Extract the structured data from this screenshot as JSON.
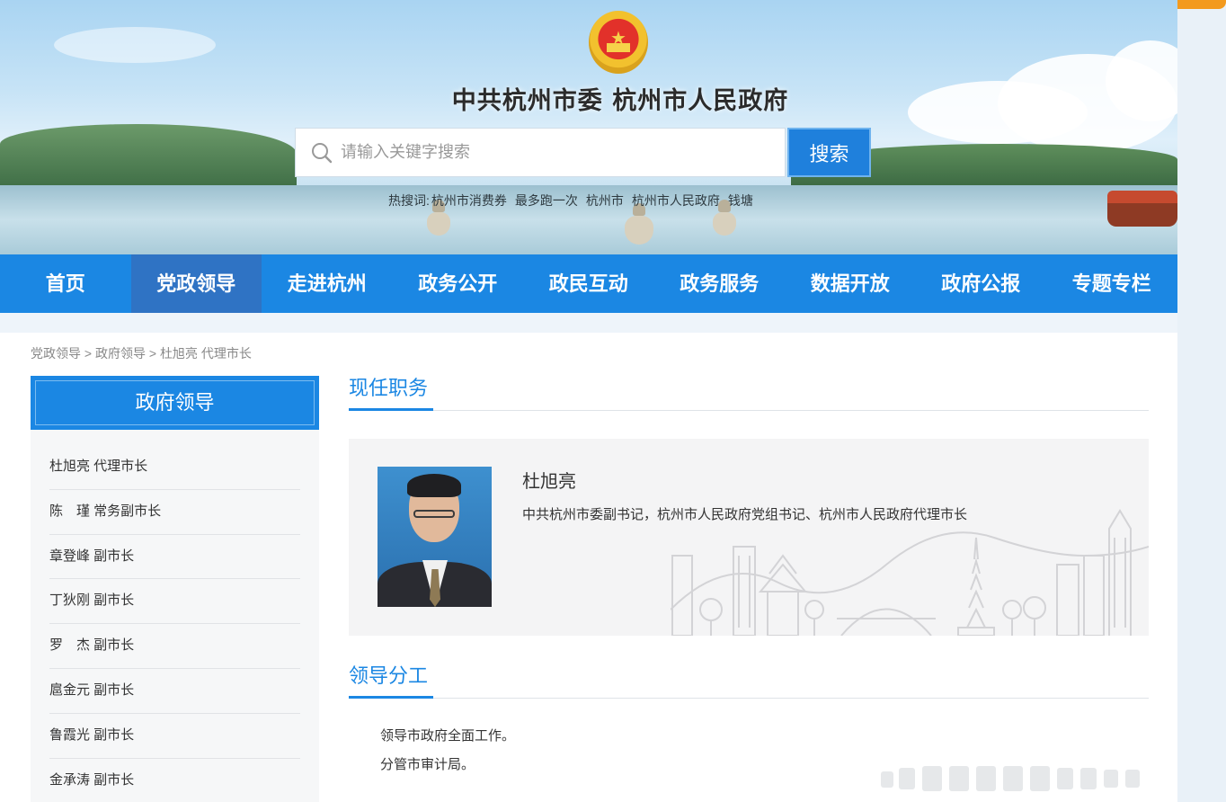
{
  "header": {
    "title": "中共杭州市委   杭州市人民政府",
    "emblem_icon": "national-emblem-icon"
  },
  "search": {
    "placeholder": "请输入关键字搜索",
    "button_label": "搜索",
    "hot_label": "热搜词:",
    "hot_words": [
      "杭州市消费券",
      "最多跑一次",
      "杭州市",
      "杭州市人民政府",
      "钱塘"
    ]
  },
  "nav": {
    "items": [
      {
        "label": "首页"
      },
      {
        "label": "党政领导",
        "active": true
      },
      {
        "label": "走进杭州"
      },
      {
        "label": "政务公开"
      },
      {
        "label": "政民互动"
      },
      {
        "label": "政务服务"
      },
      {
        "label": "数据开放"
      },
      {
        "label": "政府公报"
      },
      {
        "label": "专题专栏"
      }
    ]
  },
  "breadcrumb": {
    "items": [
      "党政领导",
      "政府领导",
      "杜旭亮 代理市长"
    ],
    "separator": " > "
  },
  "sidebar": {
    "title": "政府领导",
    "items": [
      {
        "label": "杜旭亮 代理市长"
      },
      {
        "label": "陈　瑾 常务副市长"
      },
      {
        "label": "章登峰 副市长"
      },
      {
        "label": "丁狄刚 副市长"
      },
      {
        "label": "罗　杰 副市长"
      },
      {
        "label": "扈金元 副市长"
      },
      {
        "label": "鲁霞光 副市长"
      },
      {
        "label": "金承涛 副市长"
      }
    ]
  },
  "main": {
    "current_position_title": "现任职务",
    "leader_name": "杜旭亮",
    "leader_positions": "中共杭州市委副书记，杭州市人民政府党组书记、杭州市人民政府代理市长",
    "duties_title": "领导分工",
    "duties": [
      "领导市政府全面工作。",
      "分管市审计局。"
    ]
  },
  "colors": {
    "primary_blue": "#1b87e3",
    "active_nav": "#2f73c4",
    "accent_orange": "#f39a1e"
  }
}
